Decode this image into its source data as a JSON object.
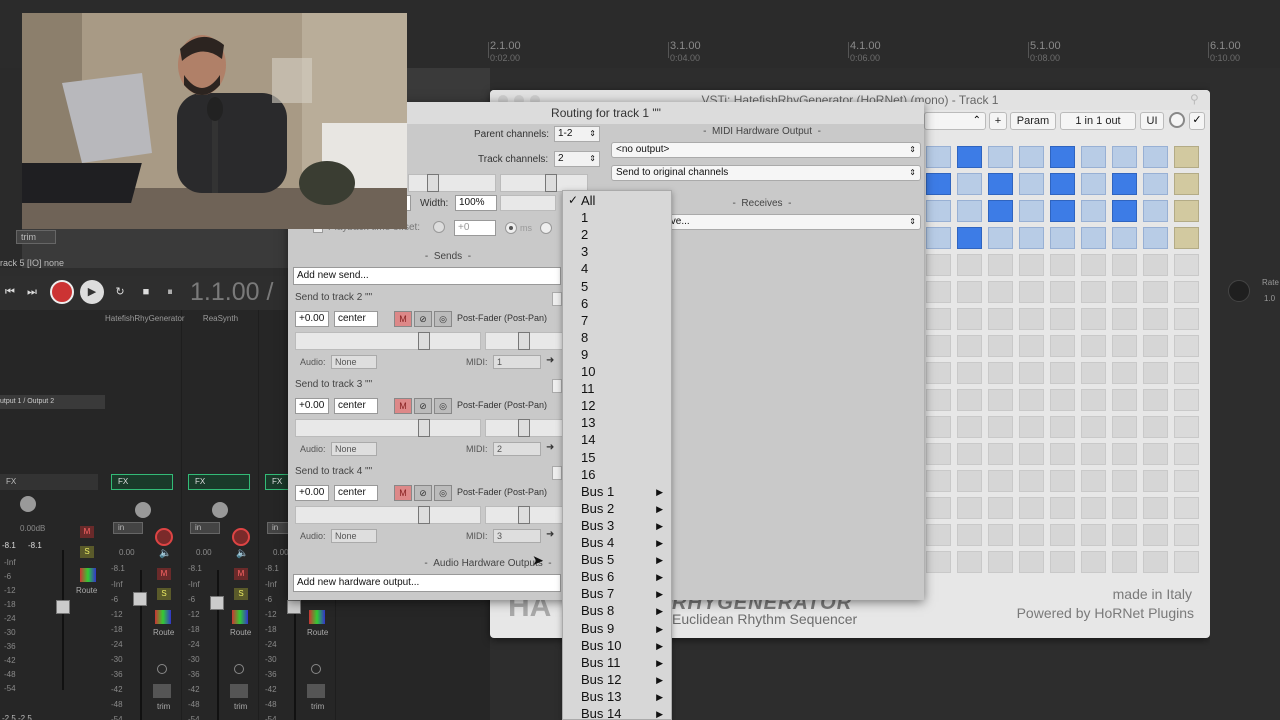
{
  "timeline": {
    "marks": [
      {
        "label": "2.1.00",
        "sub": "0:02.00"
      },
      {
        "label": "3.1.00",
        "sub": "0:04.00"
      },
      {
        "label": "4.1.00",
        "sub": "0:06.00"
      },
      {
        "label": "5.1.00",
        "sub": "0:08.00"
      },
      {
        "label": "6.1.00",
        "sub": "0:10.00"
      }
    ]
  },
  "tracks": {
    "track_label": "rack 5 [IO] none",
    "trim_label": "trim",
    "output_label": "utput 1 / Output 2"
  },
  "transport": {
    "time": "1.1.00 /",
    "buttons": [
      "⏮",
      "⏭",
      "●",
      "▶",
      "↻",
      "■",
      "⏸"
    ]
  },
  "mixer": {
    "channels": [
      {
        "name": "HatefishRhyGenerator"
      },
      {
        "name": "ReaSynth"
      },
      {
        "name": "Re"
      }
    ],
    "fx_label": "FX",
    "in_label": "in",
    "route_label": "Route",
    "trim_label": "trim",
    "master_db": "0.00dB",
    "peak_left": "-8.1",
    "peak_right": "-8.1",
    "scale": [
      "-Inf",
      "-6",
      "-12",
      "-18",
      "-24",
      "-30",
      "-36",
      "-42",
      "-48",
      "-54"
    ],
    "channel_scale": [
      "-Inf",
      "-6",
      "-12",
      "-18",
      "-24",
      "-30",
      "-36",
      "-42",
      "-48",
      "-54"
    ],
    "channel_value": "0.00",
    "channel_peak": "-8.1",
    "bottom_left": "-2.5   -2.5"
  },
  "plugin": {
    "title": "VSTi: HatefishRhyGenerator (HoRNet) (mono) - Track 1",
    "buttons": {
      "plus": "+",
      "param": "Param",
      "io": "1 in 1 out",
      "ui": "UI"
    },
    "logo": "HA",
    "logo_right": "RHYGENERATOR",
    "subtitle": "Euclidean Rhythm Sequencer",
    "made_in": "made in Italy",
    "powered": "Powered by HoRNet Plugins",
    "colors": {
      "active": "#3d7ce6",
      "inactive": "#b8cce6",
      "tan": "#d2c9a0",
      "grey": "#d6d6d6"
    },
    "grid_rows": [
      [
        "i",
        "a",
        "i",
        "i",
        "a",
        "i",
        "i",
        "t"
      ],
      [
        "a",
        "i",
        "a",
        "i",
        "a",
        "i",
        "a",
        "t"
      ],
      [
        "i",
        "i",
        "a",
        "i",
        "a",
        "i",
        "a",
        "t"
      ],
      [
        "i",
        "a",
        "i",
        "i",
        "i",
        "i",
        "i",
        "t"
      ]
    ]
  },
  "routing": {
    "title": "Routing for track 1 \"\"",
    "parent_channels_label": "Parent channels:",
    "parent_channels_value": "1-2",
    "track_channels_label": "Track channels:",
    "track_channels_value": "2",
    "width_label": "Width:",
    "width_value": "100%",
    "playback_offset_label": "Playback time offset:",
    "offset_value": "+0",
    "ms_label": "ms",
    "sends_header": "Sends",
    "add_send": "Add new send...",
    "midi_hw_header": "MIDI Hardware Output",
    "midi_hw_value": "<no output>",
    "midi_channels_value": "Send to original channels",
    "receives_header": "Receives",
    "receives_value": "eive...",
    "audio_hw_header": "Audio Hardware Outputs",
    "add_hw_output": "Add new hardware output...",
    "sends": [
      {
        "title": "Send to track 2 \"\"",
        "volume": "+0.00",
        "pan": "center",
        "mode": "Post-Fader (Post-Pan)",
        "audio_label": "Audio:",
        "audio_value": "None",
        "midi_label": "MIDI:",
        "midi_value": "1"
      },
      {
        "title": "Send to track 3 \"\"",
        "volume": "+0.00",
        "pan": "center",
        "mode": "Post-Fader (Post-Pan)",
        "audio_label": "Audio:",
        "audio_value": "None",
        "midi_label": "MIDI:",
        "midi_value": "2"
      },
      {
        "title": "Send to track 4 \"\"",
        "volume": "+0.00",
        "pan": "center",
        "mode": "Post-Fader (Post-Pan)",
        "audio_label": "Audio:",
        "audio_value": "None",
        "midi_label": "MIDI:",
        "midi_value": "3"
      }
    ]
  },
  "menu": {
    "checkmark": "✓",
    "items": [
      {
        "label": "All",
        "checked": true,
        "submenu": false
      },
      {
        "label": "1",
        "checked": false,
        "submenu": false
      },
      {
        "label": "2",
        "checked": false,
        "submenu": false
      },
      {
        "label": "3",
        "checked": false,
        "submenu": false
      },
      {
        "label": "4",
        "checked": false,
        "submenu": false
      },
      {
        "label": "5",
        "checked": false,
        "submenu": false
      },
      {
        "label": "6",
        "checked": false,
        "submenu": false
      },
      {
        "label": "7",
        "checked": false,
        "submenu": false
      },
      {
        "label": "8",
        "checked": false,
        "submenu": false
      },
      {
        "label": "9",
        "checked": false,
        "submenu": false
      },
      {
        "label": "10",
        "checked": false,
        "submenu": false
      },
      {
        "label": "11",
        "checked": false,
        "submenu": false
      },
      {
        "label": "12",
        "checked": false,
        "submenu": false
      },
      {
        "label": "13",
        "checked": false,
        "submenu": false
      },
      {
        "label": "14",
        "checked": false,
        "submenu": false
      },
      {
        "label": "15",
        "checked": false,
        "submenu": false
      },
      {
        "label": "16",
        "checked": false,
        "submenu": false
      },
      {
        "label": "Bus 1",
        "checked": false,
        "submenu": true
      },
      {
        "label": "Bus 2",
        "checked": false,
        "submenu": true
      },
      {
        "label": "Bus 3",
        "checked": false,
        "submenu": true
      },
      {
        "label": "Bus 4",
        "checked": false,
        "submenu": true
      },
      {
        "label": "Bus 5",
        "checked": false,
        "submenu": true
      },
      {
        "label": "Bus 6",
        "checked": false,
        "submenu": true
      },
      {
        "label": "Bus 7",
        "checked": false,
        "submenu": true
      },
      {
        "label": "Bus 8",
        "checked": false,
        "submenu": true
      },
      {
        "label": "Bus 9",
        "checked": false,
        "submenu": true
      },
      {
        "label": "Bus 10",
        "checked": false,
        "submenu": true
      },
      {
        "label": "Bus 11",
        "checked": false,
        "submenu": true
      },
      {
        "label": "Bus 12",
        "checked": false,
        "submenu": true
      },
      {
        "label": "Bus 13",
        "checked": false,
        "submenu": true
      },
      {
        "label": "Bus 14",
        "checked": false,
        "submenu": true
      }
    ],
    "submenu_arrow": "▶"
  },
  "right_panel": {
    "rate_label": "Rate",
    "rate_value": "1.0"
  }
}
